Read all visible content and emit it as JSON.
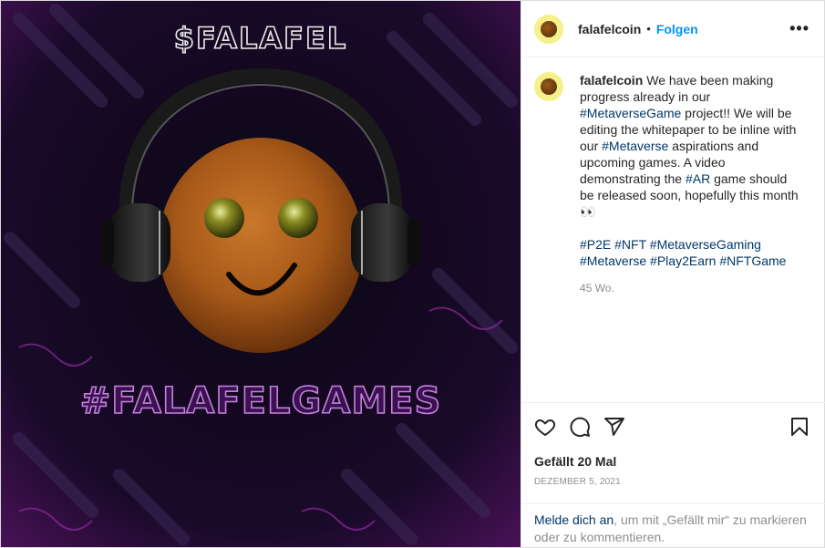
{
  "media": {
    "top_text": "$FALAFEL",
    "bottom_text": "#FALAFELGAMES"
  },
  "header": {
    "username": "falafelcoin",
    "separator": "•",
    "follow_label": "Folgen",
    "more_icon": "more-horizontal-icon"
  },
  "caption": {
    "username": "falafelcoin",
    "parts": [
      {
        "text": "We have been making progress already in our ",
        "tag": false
      },
      {
        "text": "#MetaverseGame",
        "tag": true
      },
      {
        "text": " project!! We will be editing the whitepaper to be inline with our ",
        "tag": false
      },
      {
        "text": "#Metaverse",
        "tag": true
      },
      {
        "text": " aspirations and upcoming games. A video demonstrating the ",
        "tag": false
      },
      {
        "text": "#AR",
        "tag": true
      },
      {
        "text": " game should be released soon, hopefully this month👀",
        "tag": false
      }
    ],
    "hashtags": [
      "#P2E",
      "#NFT",
      "#MetaverseGaming",
      "#Metaverse",
      "#Play2Earn",
      "#NFTGame"
    ],
    "age": "45 Wo."
  },
  "actions": {
    "icons": [
      "heart-icon",
      "comment-icon",
      "share-icon",
      "bookmark-icon"
    ],
    "likes": "Gefällt 20 Mal",
    "date": "DEZEMBER 5, 2021"
  },
  "login": {
    "link_text": "Melde dich an",
    "rest_text": ", um mit „Gefällt mir“ zu markieren oder zu kommentieren."
  },
  "colors": {
    "follow": "#0095f6",
    "hashtag": "#00376b",
    "muted": "#8e8e8e",
    "neon": "#b46bd6"
  }
}
